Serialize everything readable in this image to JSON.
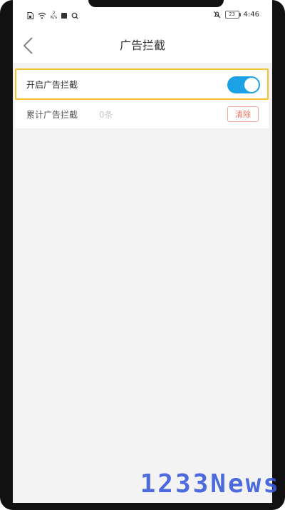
{
  "status_bar": {
    "net_speed_value": "2",
    "net_speed_unit": "K/s",
    "battery": "23",
    "time": "4:46"
  },
  "nav": {
    "title": "广告拦截"
  },
  "settings": {
    "toggle_label": "开启广告拦截",
    "toggle_on": true,
    "stats_label": "累计广告拦截",
    "stats_count": "0条",
    "clear_label": "清除"
  },
  "watermark": "1233News",
  "colors": {
    "accent": "#1aa1e6",
    "highlight": "#f5c12e",
    "clear": "#e8705e"
  }
}
